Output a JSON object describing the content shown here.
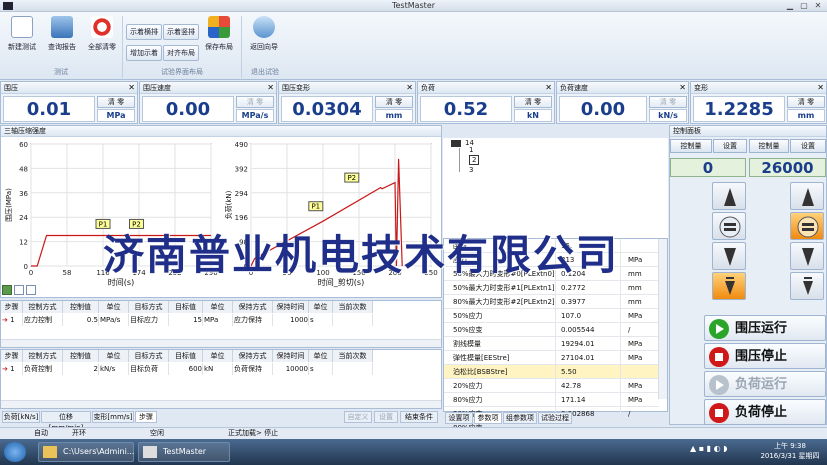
{
  "window": {
    "title": "TestMaster"
  },
  "ribbon": {
    "buttons": [
      {
        "label": "新建测试",
        "icon": "new-test-icon"
      },
      {
        "label": "查询报告",
        "icon": "report-icon"
      },
      {
        "label": "全部清零",
        "icon": "clear-all-icon"
      },
      {
        "label": "示着横排",
        "icon": ""
      },
      {
        "label": "示着竖排",
        "icon": ""
      },
      {
        "label": "增加示着",
        "icon": ""
      },
      {
        "label": "对齐布局",
        "icon": ""
      },
      {
        "label": "保存布局",
        "icon": "save-layout-icon"
      },
      {
        "label": "返回向导",
        "icon": "back-wizard-icon"
      }
    ],
    "groups": [
      "测试",
      "试验界面布局",
      "退出试验"
    ]
  },
  "meters": [
    {
      "title": "围压",
      "value": "0.01",
      "zero": "清 零",
      "unit": "MPa",
      "zero_enabled": true
    },
    {
      "title": "围压速度",
      "value": "0.00",
      "zero": "清 零",
      "unit": "MPa/s",
      "zero_enabled": false
    },
    {
      "title": "围压变形",
      "value": "0.0304",
      "zero": "清 零",
      "unit": "mm",
      "zero_enabled": true
    },
    {
      "title": "负荷",
      "value": "0.52",
      "zero": "清 零",
      "unit": "kN",
      "zero_enabled": true
    },
    {
      "title": "负荷速度",
      "value": "0.00",
      "zero": "清 零",
      "unit": "kN/s",
      "zero_enabled": false
    },
    {
      "title": "变形",
      "value": "1.2285",
      "zero": "清 零",
      "unit": "mm",
      "zero_enabled": true
    }
  ],
  "chart_panel_title": "三轴压缩强度",
  "chart_data": [
    {
      "type": "line",
      "title": "",
      "xlabel": "时间(s)",
      "ylabel": "围压(MPa)",
      "xlim": [
        0,
        290
      ],
      "ylim": [
        0,
        60
      ],
      "x_ticks": [
        "0",
        "58",
        "116",
        "174",
        "232",
        "290"
      ],
      "y_ticks": [
        "60",
        "48",
        "36",
        "24",
        "12",
        "0"
      ],
      "series": [
        {
          "x": [
            0,
            10,
            25,
            290
          ],
          "y": [
            0,
            0,
            15,
            15
          ]
        }
      ],
      "markers": [
        {
          "label": "P1",
          "x": 116,
          "y": 17
        },
        {
          "label": "P2",
          "x": 170,
          "y": 17
        }
      ]
    },
    {
      "type": "line",
      "title": "",
      "xlabel": "时间_剪切(s)",
      "ylabel": "负荷(kN)",
      "xlim": [
        0,
        250
      ],
      "ylim": [
        0,
        490
      ],
      "x_ticks": [
        "0",
        "50",
        "100",
        "150",
        "200",
        "250"
      ],
      "y_ticks": [
        "490",
        "392",
        "294",
        "196",
        "98",
        "0"
      ],
      "series": [
        {
          "x": [
            0,
            5,
            100,
            180,
            182,
            200,
            202,
            205,
            210
          ],
          "y": [
            0,
            30,
            180,
            315,
            310,
            335,
            0,
            430,
            0
          ]
        }
      ],
      "markers": [
        {
          "label": "P1",
          "x": 90,
          "y": 210
        },
        {
          "label": "P2",
          "x": 140,
          "y": 325
        }
      ]
    }
  ],
  "step_table_1": {
    "headers": [
      "步骤",
      "控制方式",
      "控制值",
      "单位",
      "目标方式",
      "目标值",
      "单位",
      "保持方式",
      "保持时间",
      "单位",
      "当前次数"
    ],
    "rows": [
      [
        "1",
        "应力控制",
        "0.5",
        "MPa/s",
        "目标应力",
        "15",
        "MPa",
        "应力保持",
        "1000",
        "s",
        ""
      ]
    ]
  },
  "step_table_2": {
    "headers": [
      "步骤",
      "控制方式",
      "控制值",
      "单位",
      "目标方式",
      "目标值",
      "单位",
      "保持方式",
      "保持时间",
      "单位",
      "当前次数"
    ],
    "rows": [
      [
        "1",
        "负荷控制",
        "2",
        "kN/s",
        "目标负荷",
        "600",
        "kN",
        "负荷保持",
        "10000",
        "s",
        ""
      ]
    ]
  },
  "tree": {
    "root": "14",
    "children": [
      "1",
      "2",
      "3"
    ]
  },
  "props": [
    {
      "k": "围压",
      "v": "15.",
      "u": ""
    },
    {
      "k": "应力",
      "v": "213",
      "u": "MPa"
    },
    {
      "k": "50%最大力时变形#0[PLExtn0]",
      "v": "0.1204",
      "u": "mm"
    },
    {
      "k": "50%最大力时变形#1[PLExtn1]",
      "v": "0.2772",
      "u": "mm"
    },
    {
      "k": "80%最大力时变形#2[PLExtn2]",
      "v": "0.3977",
      "u": "mm"
    },
    {
      "k": "50%应力",
      "v": "107.0",
      "u": "MPa"
    },
    {
      "k": "50%应变",
      "v": "0.005544",
      "u": "/"
    },
    {
      "k": "割线模量",
      "v": "19294.01",
      "u": "MPa"
    },
    {
      "k": "弹性模量[EEStre]",
      "v": "27104.01",
      "u": "MPa"
    },
    {
      "k": "泊松比[BSBStre]",
      "v": "5.50",
      "u": ""
    },
    {
      "k": "20%应力",
      "v": "42.78",
      "u": "MPa"
    },
    {
      "k": "80%应力",
      "v": "171.14",
      "u": "MPa"
    },
    {
      "k": "20%应变",
      "v": "0.002868",
      "u": "/"
    },
    {
      "k": "80%应变",
      "v": "",
      "u": ""
    }
  ],
  "props_tabs": [
    "设置项",
    "参数项",
    "组参数项",
    "试验过程"
  ],
  "bottom_tabs": [
    "负荷[kN/s]",
    "位移[mm/min]",
    "变形[mm/s]",
    "步骤"
  ],
  "bottom_buttons": [
    "自定义",
    "设置",
    "结束条件"
  ],
  "control": {
    "title": "控制面板",
    "left_label": "控制量",
    "left_set": "设置",
    "right_label": "控制量",
    "right_set": "设置",
    "left_value": "0",
    "right_value": "26000",
    "run_buttons": [
      {
        "label": "围压运行",
        "color": "#2aa52a",
        "enabled": true
      },
      {
        "label": "围压停止",
        "color": "#d01818",
        "enabled": true
      },
      {
        "label": "负荷运行",
        "color": "#b8c2cc",
        "enabled": false
      },
      {
        "label": "负荷停止",
        "color": "#d01818",
        "enabled": true
      }
    ]
  },
  "status": {
    "mode": "自动",
    "loop": "开环",
    "state": "空闲",
    "stage": "正式加载> 停止"
  },
  "taskbar": {
    "item1": "C:\\Users\\Admini...",
    "item2": "TestMaster",
    "time": "上午 9:38",
    "date": "2016/3/31 星期四"
  },
  "watermark": "济南普业机电技术有限公司"
}
